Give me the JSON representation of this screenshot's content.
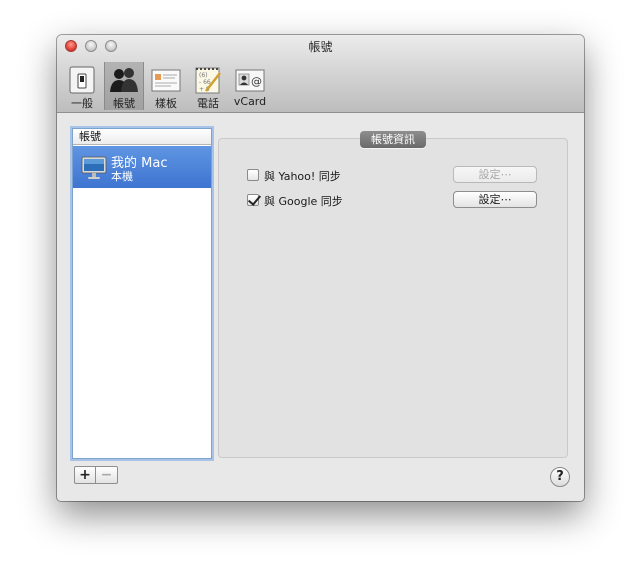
{
  "window": {
    "title": "帳號",
    "traffic_lights": [
      "close",
      "minimize",
      "zoom"
    ]
  },
  "toolbar": {
    "items": [
      {
        "label": "一般",
        "icon": "switch-icon",
        "selected": false
      },
      {
        "label": "帳號",
        "icon": "people-icon",
        "selected": true
      },
      {
        "label": "樣板",
        "icon": "template-card-icon",
        "selected": false
      },
      {
        "label": "電話",
        "icon": "phone-notepad-icon",
        "selected": false
      },
      {
        "label": "vCard",
        "icon": "vcard-icon",
        "selected": false
      }
    ]
  },
  "accounts_list": {
    "header": "帳號",
    "items": [
      {
        "name": "我的 Mac",
        "subtitle": "本機",
        "icon": "imac-icon",
        "selected": true
      }
    ]
  },
  "account_info": {
    "tab_label": "帳號資訊",
    "sync_options": [
      {
        "label": "與 Yahoo! 同步",
        "checked": false,
        "button_label": "設定⋯",
        "button_enabled": false
      },
      {
        "label": "與 Google 同步",
        "checked": true,
        "button_label": "設定⋯",
        "button_enabled": true
      }
    ]
  },
  "bottom_controls": {
    "add_label": "+",
    "remove_label": "−",
    "help_label": "?"
  },
  "colors": {
    "selection": "#3f74d1",
    "traffic_close": "#e0443a",
    "group_tab": "#7a7a7a"
  }
}
